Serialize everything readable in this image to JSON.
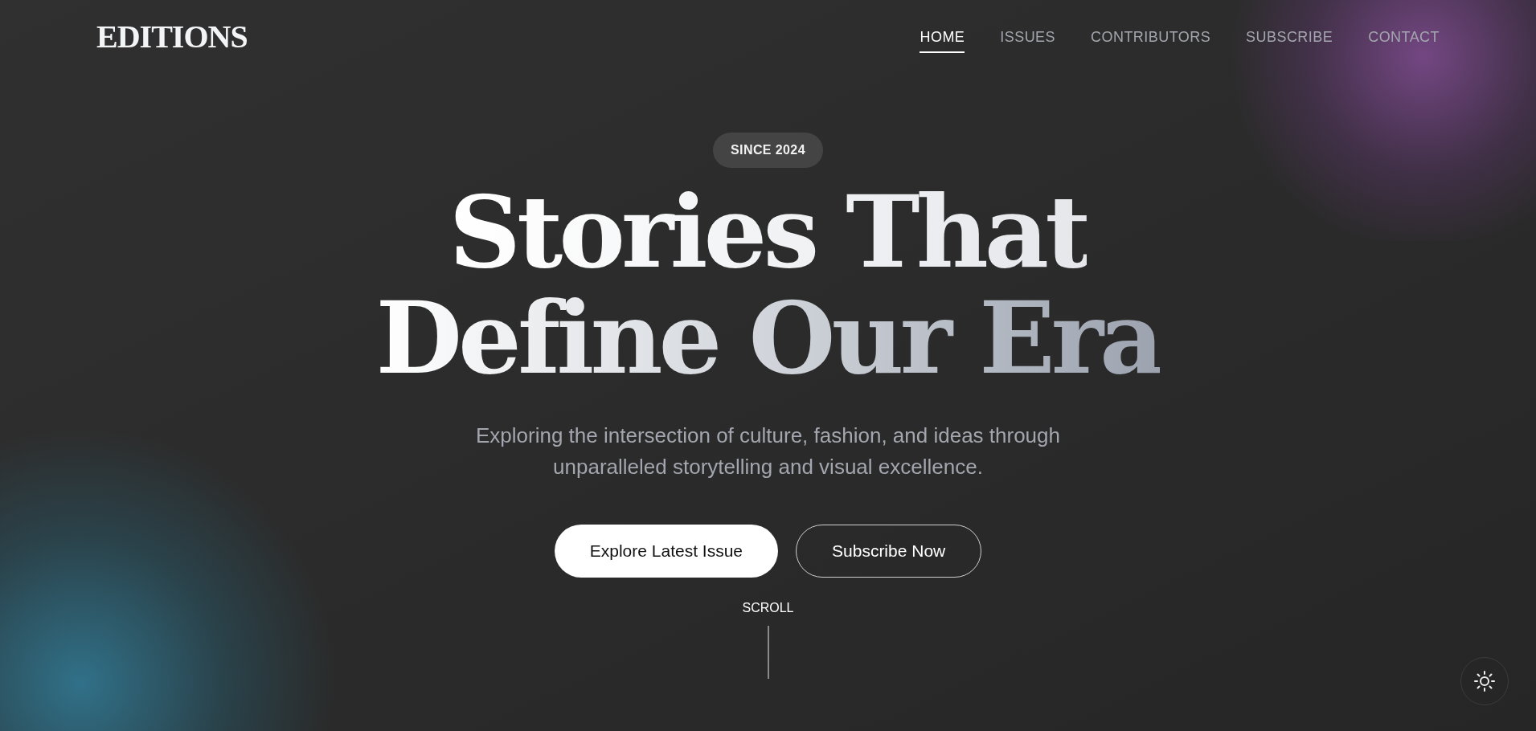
{
  "logo": "EDITIONS",
  "nav": [
    {
      "label": "HOME",
      "selected": true
    },
    {
      "label": "ISSUES",
      "selected": false
    },
    {
      "label": "CONTRIBUTORS",
      "selected": false
    },
    {
      "label": "SUBSCRIBE",
      "selected": false
    },
    {
      "label": "CONTACT",
      "selected": false
    }
  ],
  "hero": {
    "badge": "SINCE 2024",
    "headline_lines": [
      "Stories That",
      "Define Our Era"
    ],
    "subtitle": "Exploring the intersection of culture, fashion, and ideas through unparalleled storytelling and visual excellence.",
    "buttons": [
      {
        "label": "Explore Latest Issue",
        "kind": "primary"
      },
      {
        "label": "Subscribe Now",
        "kind": "outline"
      }
    ],
    "scroll_hint": "SCROLL"
  }
}
